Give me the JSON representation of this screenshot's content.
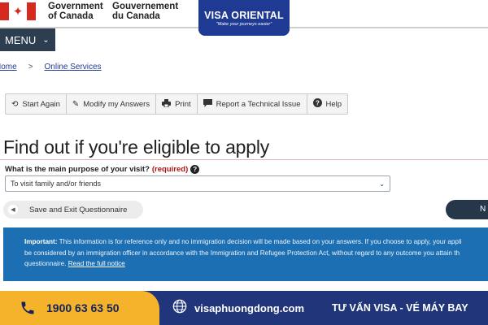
{
  "header": {
    "gov_en": [
      "Government",
      "of Canada"
    ],
    "gov_fr": [
      "Gouvernement",
      "du Canada"
    ],
    "brand_name": "VISA ORIENTAL",
    "brand_tagline": "\"Make your journeys easier\""
  },
  "menu": {
    "label": "MENU"
  },
  "breadcrumb": {
    "home": "Home",
    "separator": ">",
    "online_services": "Online Services"
  },
  "toolbar": {
    "start_again": "Start Again",
    "modify_answers": "Modify my Answers",
    "print": "Print",
    "report_issue": "Report a Technical Issue",
    "help": "Help"
  },
  "page": {
    "title": "Find out if you're eligible to apply",
    "question": "What is the main purpose of your visit?",
    "required": "(required)",
    "select_value": "To visit family and/or friends"
  },
  "actions": {
    "save_exit": "Save and Exit Questionnaire",
    "next": "N"
  },
  "notice": {
    "label": "Important:",
    "line1": "This information is for reference only and no immigration decision will be made based on your answers. If you choose to apply, your appli",
    "line2": "be considered by an immigration officer in accordance with the Immigration and Refugee Protection Act, without regard to any outcome you attain th",
    "line3": "questionnaire.",
    "link": "Read the full notice"
  },
  "banner": {
    "phone": "1900 63 63 50",
    "website": "visaphuongdong.com",
    "slogan": "TƯ VẤN VISA - VÉ MÁY BAY"
  },
  "colors": {
    "brand_blue": "#1f3a93",
    "canada_red": "#d52b1e",
    "notice_blue": "#1c6fb3",
    "banner_yellow": "#f5b32b",
    "banner_navy": "#21367a"
  }
}
